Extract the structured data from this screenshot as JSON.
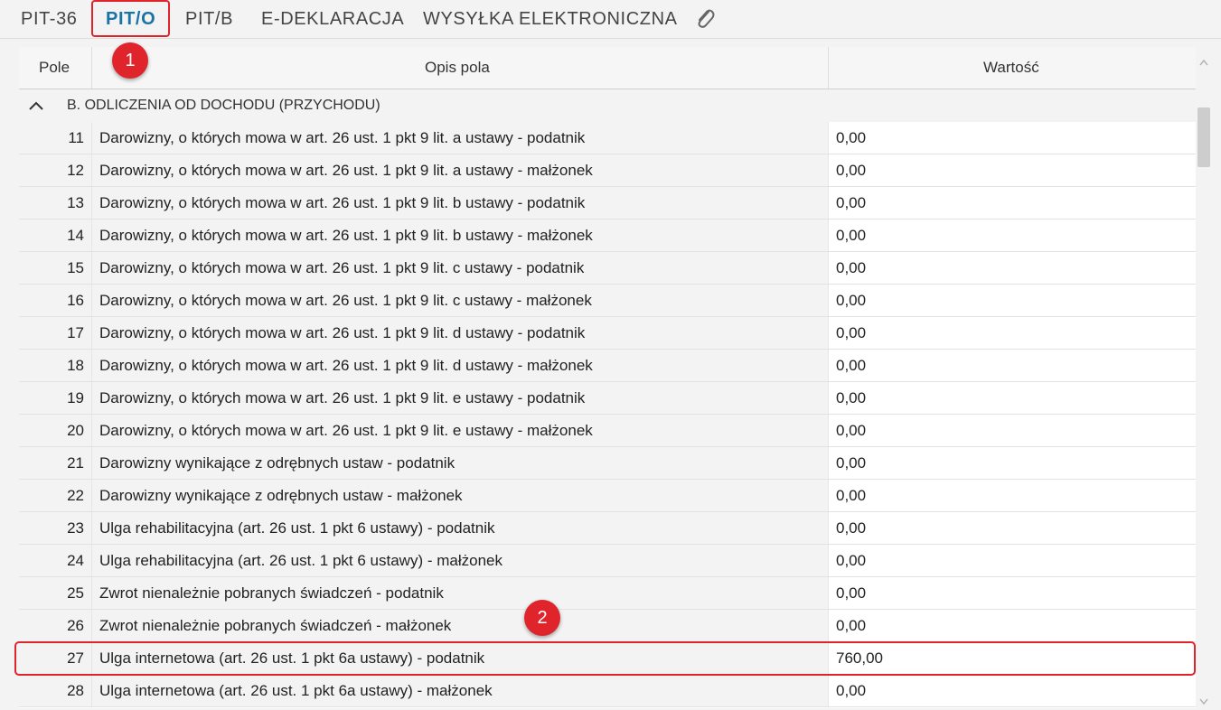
{
  "tabs": [
    {
      "label": "PIT-36"
    },
    {
      "label": "PIT/O"
    },
    {
      "label": "PIT/B"
    },
    {
      "label": "E-DEKLARACJA"
    },
    {
      "label": "WYSYŁKA ELEKTRONICZNA"
    }
  ],
  "attachment_icon": "paperclip-icon",
  "table": {
    "columns": [
      "Pole",
      "Opis pola",
      "Wartość"
    ],
    "group": "B. ODLICZENIA OD DOCHODU (PRZYCHODU)",
    "rows": [
      {
        "pole": "11",
        "opis": "Darowizny, o których mowa w art. 26 ust. 1 pkt 9 lit. a ustawy - podatnik",
        "wartosc": "0,00"
      },
      {
        "pole": "12",
        "opis": "Darowizny, o których mowa w art. 26 ust. 1 pkt 9 lit. a ustawy - małżonek",
        "wartosc": "0,00"
      },
      {
        "pole": "13",
        "opis": "Darowizny, o których mowa w art. 26 ust. 1 pkt 9 lit. b ustawy - podatnik",
        "wartosc": "0,00"
      },
      {
        "pole": "14",
        "opis": "Darowizny, o których mowa w art. 26 ust. 1 pkt 9 lit. b ustawy - małżonek",
        "wartosc": "0,00"
      },
      {
        "pole": "15",
        "opis": "Darowizny, o których mowa w art. 26 ust. 1 pkt 9 lit. c ustawy - podatnik",
        "wartosc": "0,00"
      },
      {
        "pole": "16",
        "opis": "Darowizny, o których mowa w art. 26 ust. 1 pkt 9 lit. c ustawy - małżonek",
        "wartosc": "0,00"
      },
      {
        "pole": "17",
        "opis": "Darowizny, o których mowa w art. 26 ust. 1 pkt 9 lit. d ustawy - podatnik",
        "wartosc": "0,00"
      },
      {
        "pole": "18",
        "opis": "Darowizny, o których mowa w art. 26 ust. 1 pkt 9 lit. d ustawy - małżonek",
        "wartosc": "0,00"
      },
      {
        "pole": "19",
        "opis": "Darowizny, o których mowa w art. 26 ust. 1 pkt 9 lit. e ustawy - podatnik",
        "wartosc": "0,00"
      },
      {
        "pole": "20",
        "opis": "Darowizny, o których mowa w art. 26 ust. 1 pkt 9 lit. e ustawy - małżonek",
        "wartosc": "0,00"
      },
      {
        "pole": "21",
        "opis": "Darowizny wynikające z odrębnych ustaw - podatnik",
        "wartosc": "0,00"
      },
      {
        "pole": "22",
        "opis": "Darowizny wynikające z odrębnych ustaw - małżonek",
        "wartosc": "0,00"
      },
      {
        "pole": "23",
        "opis": "Ulga rehabilitacyjna (art. 26 ust. 1 pkt 6 ustawy) - podatnik",
        "wartosc": "0,00"
      },
      {
        "pole": "24",
        "opis": "Ulga rehabilitacyjna (art. 26 ust. 1 pkt 6 ustawy) - małżonek",
        "wartosc": "0,00"
      },
      {
        "pole": "25",
        "opis": "Zwrot nienależnie pobranych świadczeń - podatnik",
        "wartosc": "0,00"
      },
      {
        "pole": "26",
        "opis": "Zwrot nienależnie pobranych świadczeń - małżonek",
        "wartosc": "0,00"
      },
      {
        "pole": "27",
        "opis": "Ulga internetowa (art. 26 ust. 1 pkt 6a ustawy) - podatnik",
        "wartosc": "760,00"
      },
      {
        "pole": "28",
        "opis": "Ulga internetowa (art. 26 ust. 1 pkt 6a ustawy) - małżonek",
        "wartosc": "0,00"
      }
    ]
  },
  "annotations": {
    "badge1": "1",
    "badge2": "2"
  },
  "colors": {
    "accent": "#1a73a6",
    "annotation": "#e0242c"
  }
}
